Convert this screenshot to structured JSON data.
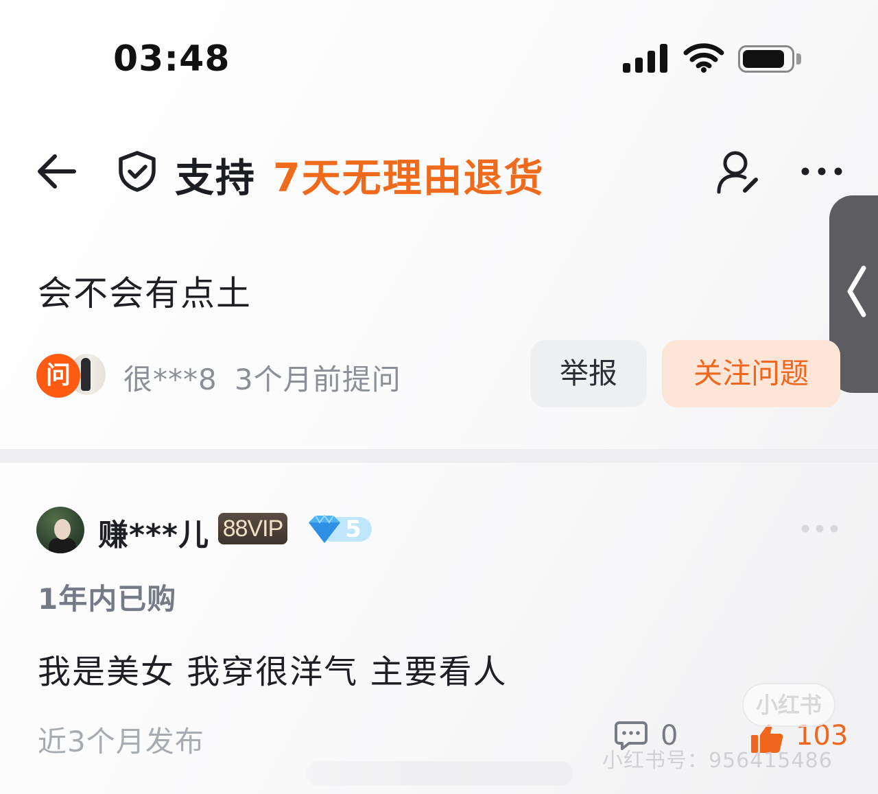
{
  "status_bar": {
    "time": "03:48"
  },
  "nav": {
    "support_label": "支持",
    "policy_label": "7天无理由退货"
  },
  "question": {
    "title": "会不会有点土",
    "ask_badge": "问",
    "asker_name": "很***8",
    "asked_time": "3个月前提问",
    "report_label": "举报",
    "follow_label": "关注问题"
  },
  "answer": {
    "author_name": "赚***儿",
    "vip_badge": "88VIP",
    "level": "5",
    "purchase_tag": "1年内已购",
    "text": "我是美女 我穿很洋气 主要看人",
    "publish_time": "近3个月发布",
    "comment_count": "0",
    "like_count": "103"
  },
  "watermark": {
    "logo": "小红书",
    "id_text": "小红书号：956415486"
  },
  "colors": {
    "accent_orange": "#f06a1b",
    "follow_bg": "#fde5d8",
    "report_bg": "#eef0f2",
    "handle_gray": "#5d5d61"
  },
  "icons": {
    "back": "arrow-left-icon",
    "shield": "shield-check-icon",
    "user": "user-edit-icon",
    "more": "more-horizontal-icon",
    "handle": "chevron-left-icon",
    "diamond": "diamond-icon",
    "comment": "comment-icon",
    "like": "thumbs-up-icon",
    "signal": "cellular-signal-icon",
    "wifi": "wifi-icon",
    "battery": "battery-icon"
  }
}
